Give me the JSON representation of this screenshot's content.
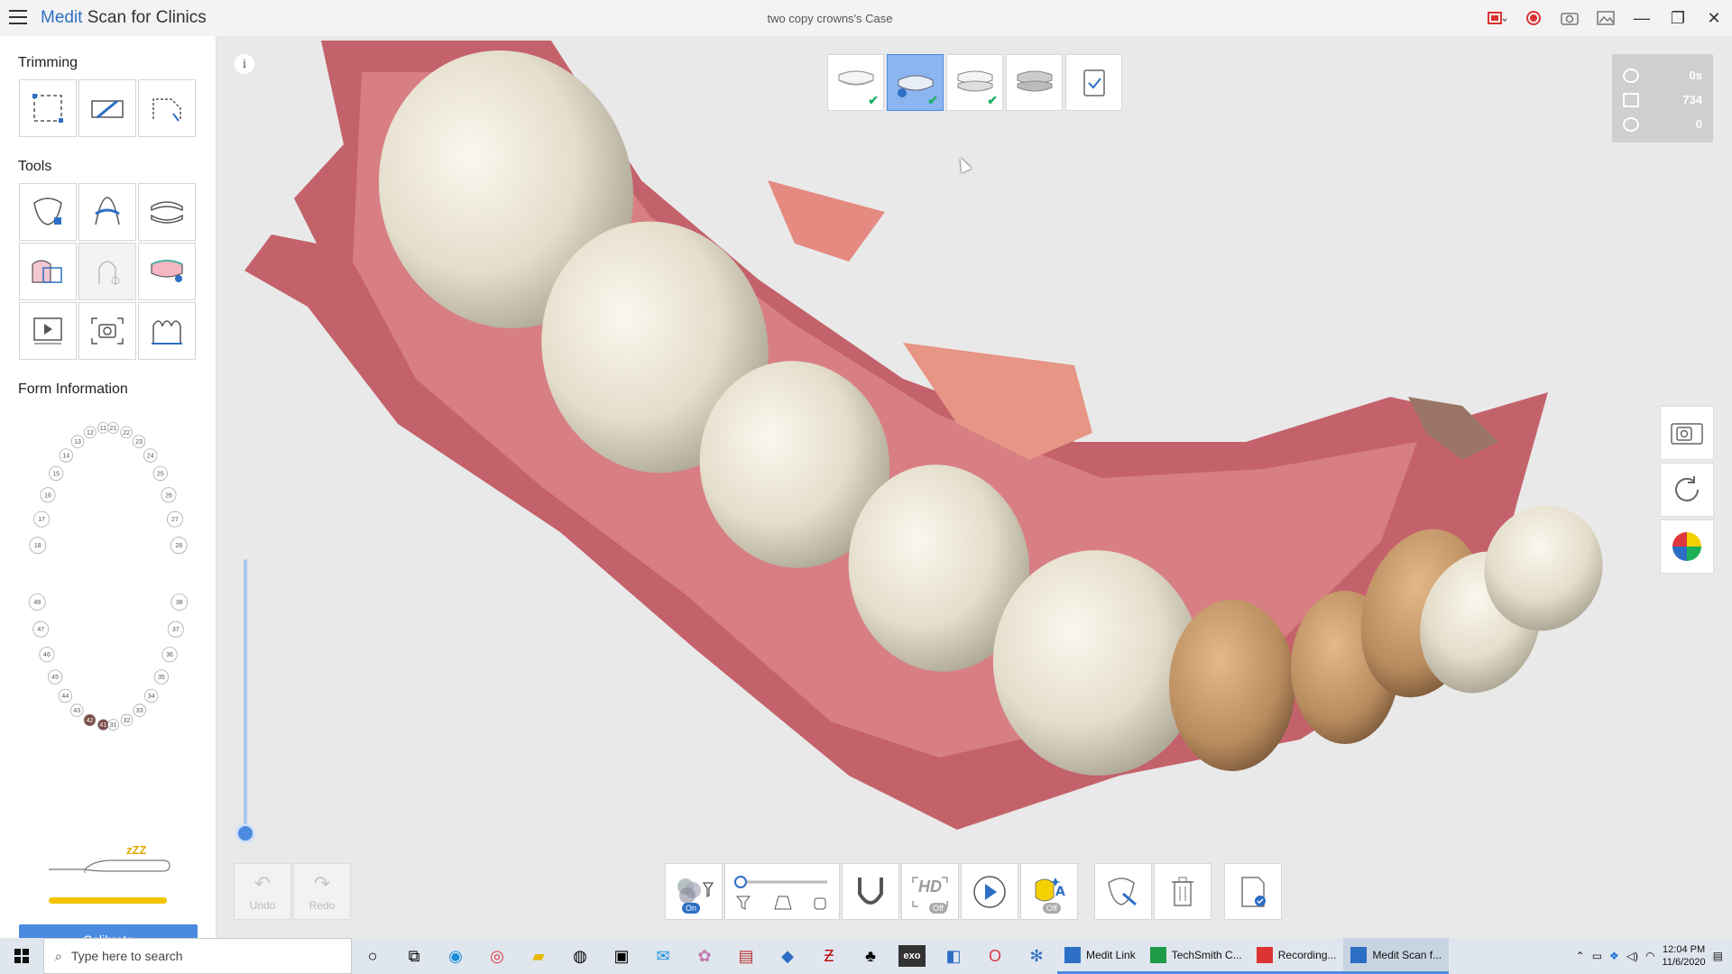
{
  "titlebar": {
    "brand": "Medit",
    "app_rest": " Scan for Clinics",
    "case_title": "two copy crowns's Case"
  },
  "left_panel": {
    "trimming_title": "Trimming",
    "tools_title": "Tools",
    "form_title": "Form Information",
    "calibrate_label": "Calibrate",
    "scanner_status": "zZZ",
    "progress_fraction": 1.0
  },
  "tooth_chart": {
    "upper_right": [
      "11",
      "12",
      "13",
      "14",
      "15",
      "16",
      "17",
      "18"
    ],
    "upper_left": [
      "21",
      "22",
      "23",
      "24",
      "25",
      "26",
      "27",
      "28"
    ],
    "lower_right": [
      "41",
      "42",
      "43",
      "44",
      "45",
      "46",
      "47",
      "48"
    ],
    "lower_left": [
      "31",
      "32",
      "33",
      "34",
      "35",
      "36",
      "37",
      "38"
    ],
    "selected": [
      "41",
      "42"
    ]
  },
  "viewport": {
    "info_label": "i",
    "stats": {
      "time": "0s",
      "frames": "734",
      "count": "0"
    },
    "stages": [
      {
        "name": "upper",
        "done": true,
        "active": false
      },
      {
        "name": "lower",
        "done": true,
        "active": true
      },
      {
        "name": "occlusion",
        "done": true,
        "active": false
      },
      {
        "name": "occlusion-2",
        "done": false,
        "active": false
      },
      {
        "name": "review",
        "done": false,
        "active": false
      }
    ]
  },
  "bottom": {
    "undo_label": "Undo",
    "redo_label": "Redo",
    "filter_badge": "On",
    "hd_label": "HD",
    "hd_badge": "Off",
    "ai_badge": "Off"
  },
  "taskbar": {
    "search_placeholder": "Type here to search",
    "apps": [
      {
        "label": "Medit Link",
        "color": "#2d6fc4"
      },
      {
        "label": "TechSmith C...",
        "color": "#1e9b48"
      },
      {
        "label": "Recording...",
        "color": "#d33"
      },
      {
        "label": "Medit Scan f...",
        "color": "#2d6fc4"
      }
    ],
    "time": "12:04 PM",
    "date": "11/6/2020"
  },
  "colors": {
    "accent": "#4a8be0",
    "brand": "#2d6fc4",
    "check": "#1bb06a",
    "progress": "#f4c400"
  }
}
